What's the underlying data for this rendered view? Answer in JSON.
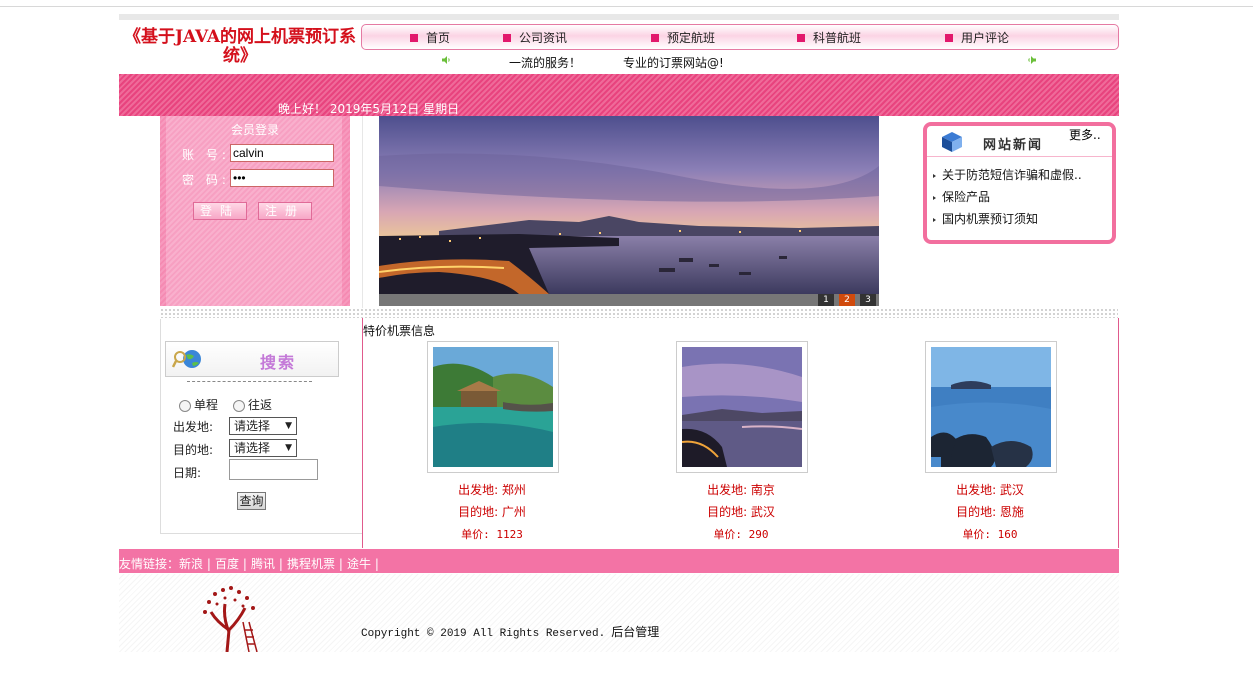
{
  "site": {
    "title": "《基于JAVA的网上机票预订系统》",
    "slogan_left": "一流的服务！",
    "slogan_right": "专业的订票网站@!"
  },
  "nav": {
    "items": [
      {
        "label": "首页"
      },
      {
        "label": "公司资讯"
      },
      {
        "label": "预定航班"
      },
      {
        "label": "科普航班"
      },
      {
        "label": "用户评论"
      }
    ]
  },
  "greeting": "晚上好！  2019年5月12日  星期日",
  "login": {
    "title": "会员登录",
    "account_label": "账  号:",
    "account_value": "calvin",
    "password_label": "密  码:",
    "password_value": "•••",
    "login_button": "登陆",
    "register_button": "注册"
  },
  "search": {
    "title": "搜索",
    "one_way": "单程",
    "round_trip": "往返",
    "from_label": "出发地:",
    "from_value": "请选择",
    "to_label": "目的地:",
    "to_value": "请选择",
    "date_label": "日期:",
    "query_button": "查询"
  },
  "banner": {
    "pages": [
      "1",
      "2",
      "3"
    ],
    "active_page": "2"
  },
  "news": {
    "title": "网站新闻",
    "more": "更多..",
    "items": [
      {
        "text": "关于防范短信诈骗和虚假.."
      },
      {
        "text": "保险产品"
      },
      {
        "text": "国内机票预订须知"
      }
    ]
  },
  "tickets": {
    "title": "特价机票信息",
    "cards": [
      {
        "from": "出发地: 郑州",
        "to": "目的地: 广州",
        "price": "单价: 1123"
      },
      {
        "from": "出发地: 南京",
        "to": "目的地: 武汉",
        "price": "单价: 290"
      },
      {
        "from": "出发地: 武汉",
        "to": "目的地: 恩施",
        "price": "单价: 160"
      }
    ]
  },
  "links": {
    "label": "友情链接：",
    "items": [
      "新浪",
      "百度",
      "腾讯",
      "携程机票",
      "途牛"
    ]
  },
  "footer": {
    "copyright": "Copyright © 2019 All Rights Reserved.",
    "admin": "后台管理"
  },
  "colors": {
    "brand_pink": "#e8437e",
    "title_red": "#d4101c",
    "price_red": "#cc0000"
  }
}
